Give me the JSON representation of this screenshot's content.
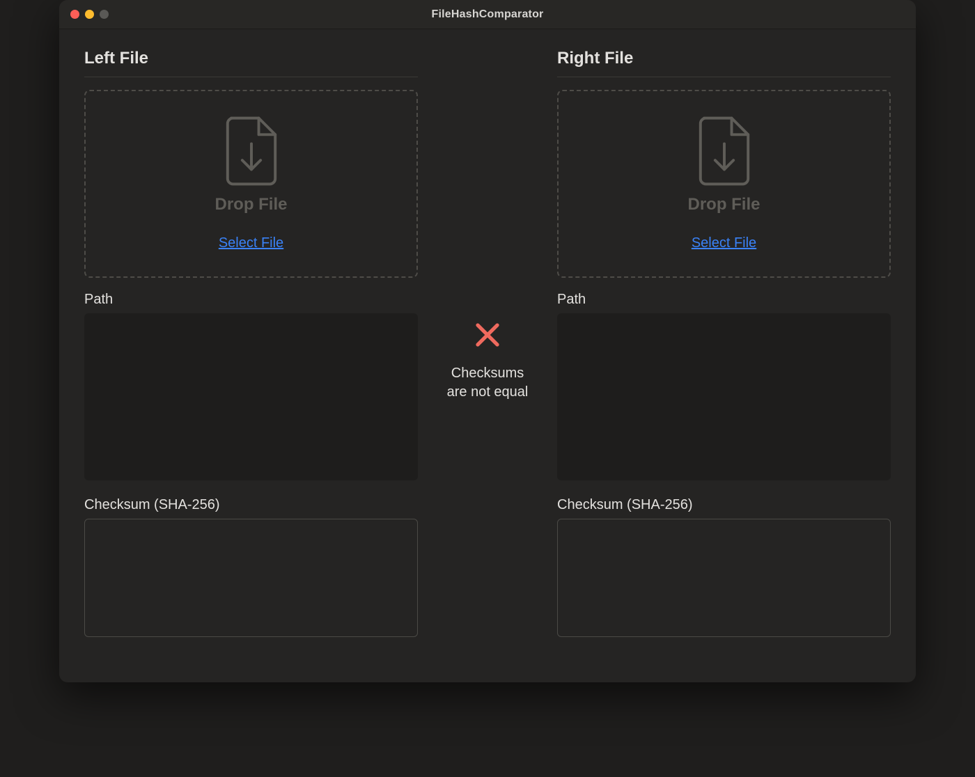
{
  "titlebar": {
    "title": "FileHashComparator"
  },
  "left": {
    "heading": "Left File",
    "drop_text": "Drop File",
    "select_label": "Select File",
    "path_label": "Path",
    "path_value": "",
    "checksum_label": "Checksum (SHA-256)",
    "checksum_value": ""
  },
  "center": {
    "status": "Checksums\nare not equal",
    "status_color": "#ef6a5e"
  },
  "right": {
    "heading": "Right File",
    "drop_text": "Drop File",
    "select_label": "Select File",
    "path_label": "Path",
    "path_value": "",
    "checksum_label": "Checksum (SHA-256)",
    "checksum_value": ""
  },
  "icons": {
    "file_download": "file-download-icon",
    "x_mark": "x-mark-icon"
  }
}
